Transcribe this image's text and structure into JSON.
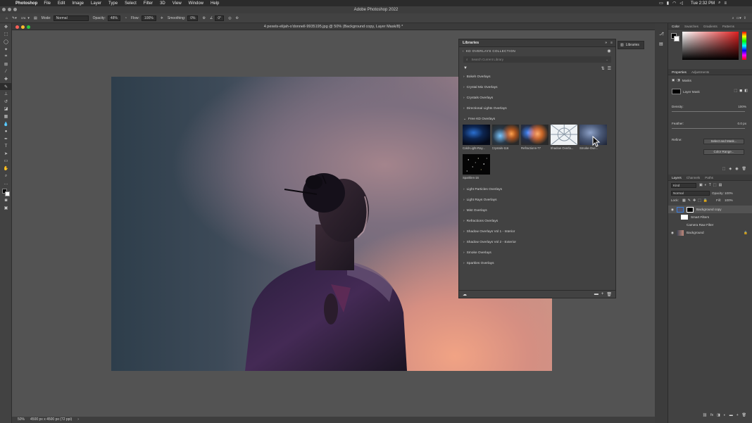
{
  "menubar": {
    "app_name": "Photoshop",
    "items": [
      "File",
      "Edit",
      "Image",
      "Layer",
      "Type",
      "Select",
      "Filter",
      "3D",
      "View",
      "Window",
      "Help"
    ],
    "clock": "Tue 2:32 PM"
  },
  "window": {
    "title": "Adobe Photoshop 2022"
  },
  "options_bar": {
    "brush_size": "378",
    "mode_label": "Mode:",
    "mode_value": "Normal",
    "opacity_label": "Opacity:",
    "opacity_value": "48%",
    "flow_label": "Flow:",
    "flow_value": "100%",
    "smoothing_label": "Smoothing:",
    "smoothing_value": "0%",
    "angle_value": "0°"
  },
  "document": {
    "tab_title": "4 pexels-elijah-o'donnell-9935195.jpg @ 50% (Background copy, Layer Mask/8) *",
    "zoom": "50%",
    "dimensions": "4500 px x 4500 px (72 ppi)"
  },
  "libraries": {
    "panel_title": "Libraries",
    "dock_label": "Libraries",
    "collection_name": "KD OVERLAYS COLLECTION",
    "search_placeholder": "Search Current Library",
    "groups_before": [
      "Bokeh Overlays",
      "Crystal Mix Overlays",
      "Crystals Overlays",
      "Directional Lights Overlays",
      "Free KD Overlays"
    ],
    "assets": [
      {
        "name": "Cold-Light-Ray..."
      },
      {
        "name": "Crystals-116"
      },
      {
        "name": "Refractions-77"
      },
      {
        "name": "Shadow Overla..."
      },
      {
        "name": "Smoke-Ove..."
      },
      {
        "name": "Sparkles-16"
      }
    ],
    "groups_after": [
      "Light Particles Overlays",
      "Light Rays Overlays",
      "Mist Overlays",
      "Refractions Overlays",
      "Shadow Overlays Vol 1 - Interior",
      "Shadow Overlays Vol 2 - Exterior",
      "Smoke Overlays",
      "Sparkles Overlays"
    ]
  },
  "color_panel": {
    "tabs": [
      "Color",
      "Swatches",
      "Gradients",
      "Patterns"
    ]
  },
  "properties": {
    "tabs": [
      "Properties",
      "Adjustments"
    ],
    "masks_label": "Masks",
    "layer_mask_label": "Layer Mask",
    "density_label": "Density:",
    "density_value": "100%",
    "feather_label": "Feather:",
    "feather_value": "0.0 px",
    "refine_label": "Refine:",
    "select_mask_button": "Select and Mask...",
    "color_range_button": "Color Range..."
  },
  "layers": {
    "tabs": [
      "Layers",
      "Channels",
      "Paths"
    ],
    "kind_label": "Kind",
    "blend_mode": "Normal",
    "opacity_label": "Opacity:",
    "opacity_value": "100%",
    "lock_label": "Lock:",
    "fill_label": "Fill:",
    "fill_value": "100%",
    "rows": [
      {
        "name": "Background copy"
      },
      {
        "name": "Smart Filters"
      },
      {
        "name": "Camera Raw Filter"
      },
      {
        "name": "Background"
      }
    ]
  },
  "colors": {
    "accent": "#3b7ed6",
    "panel_bg": "#424242",
    "canvas_bg": "#535353"
  }
}
